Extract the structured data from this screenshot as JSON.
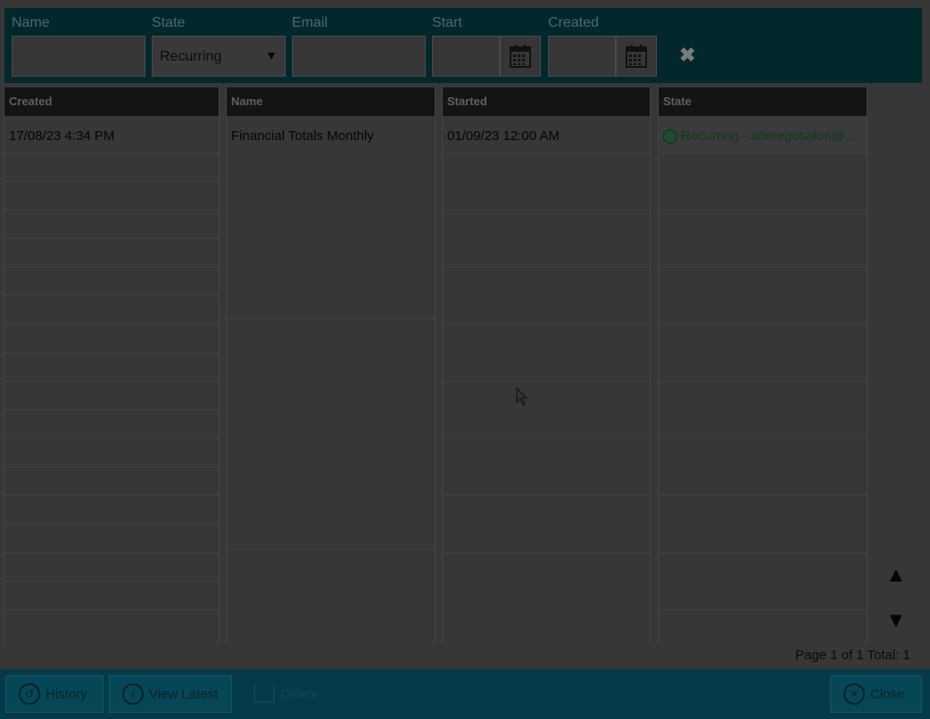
{
  "filters": {
    "name_label": "Name",
    "state_label": "State",
    "state_value": "Recurring",
    "email_label": "Email",
    "start_label": "Start",
    "created_label": "Created"
  },
  "columns": {
    "created": "Created",
    "name": "Name",
    "started": "Started",
    "state": "State"
  },
  "rows": [
    {
      "created": "17/08/23 4:34 PM",
      "name": "Financial Totals Monthly",
      "started": "01/09/23 12:00 AM",
      "state": "Recurring - alteregosalon@..."
    }
  ],
  "pager": {
    "page_text": "Page 1 of 1",
    "total_text": "Total: 1"
  },
  "toolbar": {
    "history_label": "History",
    "view_latest_label": "View Latest",
    "delete_label": "Delete",
    "close_label": "Close"
  },
  "icons": [
    "calendar-icon",
    "clear-icon",
    "recurring-icon",
    "history-icon",
    "download-icon",
    "delete-icon",
    "close-icon",
    "scroll-up-icon",
    "scroll-down-icon"
  ]
}
